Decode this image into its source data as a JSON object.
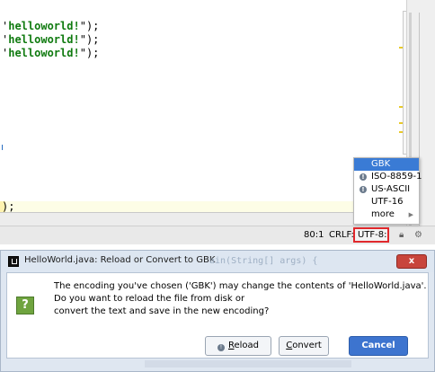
{
  "editor": {
    "code_lines": [
      {
        "prefix": "'",
        "string": "helloworld!",
        "suffix": "\");"
      },
      {
        "prefix": "'",
        "string": "helloworld!",
        "suffix": "\");"
      },
      {
        "prefix": "'",
        "string": "helloworld!",
        "suffix": "\");"
      }
    ],
    "bottom_line": ");"
  },
  "status_bar": {
    "position": "80:1",
    "line_separator": "CRLF:",
    "encoding": "UTF-8:",
    "lock_icon": "lock-icon",
    "hector_icon": "inspection-icon"
  },
  "encoding_popup": {
    "items": [
      {
        "label": "GBK",
        "selected": true,
        "warning": false,
        "submenu": false
      },
      {
        "label": "ISO-8859-1",
        "selected": false,
        "warning": true,
        "submenu": false
      },
      {
        "label": "US-ASCII",
        "selected": false,
        "warning": true,
        "submenu": false
      },
      {
        "label": "UTF-16",
        "selected": false,
        "warning": false,
        "submenu": false
      },
      {
        "label": "more",
        "selected": false,
        "warning": false,
        "submenu": true
      }
    ]
  },
  "dialog": {
    "title": "HelloWorld.java: Reload or Convert to GBK",
    "close_label": "x",
    "background_hint": "ain(String[] args) {",
    "message_lines": [
      "The encoding you've chosen ('GBK') may change the contents of 'HelloWorld.java'.",
      "Do you want to reload the file from disk or",
      "convert the text and save in the new encoding?"
    ],
    "buttons": {
      "reload": {
        "mnemonic": "R",
        "rest": "eload"
      },
      "convert": {
        "mnemonic": "C",
        "rest": "onvert"
      },
      "cancel": "Cancel"
    }
  },
  "colors": {
    "accent": "#3a7bd5",
    "string_literal": "#0f7a0f",
    "highlight_border": "#e0282c",
    "question_icon": "#6fa43f"
  }
}
